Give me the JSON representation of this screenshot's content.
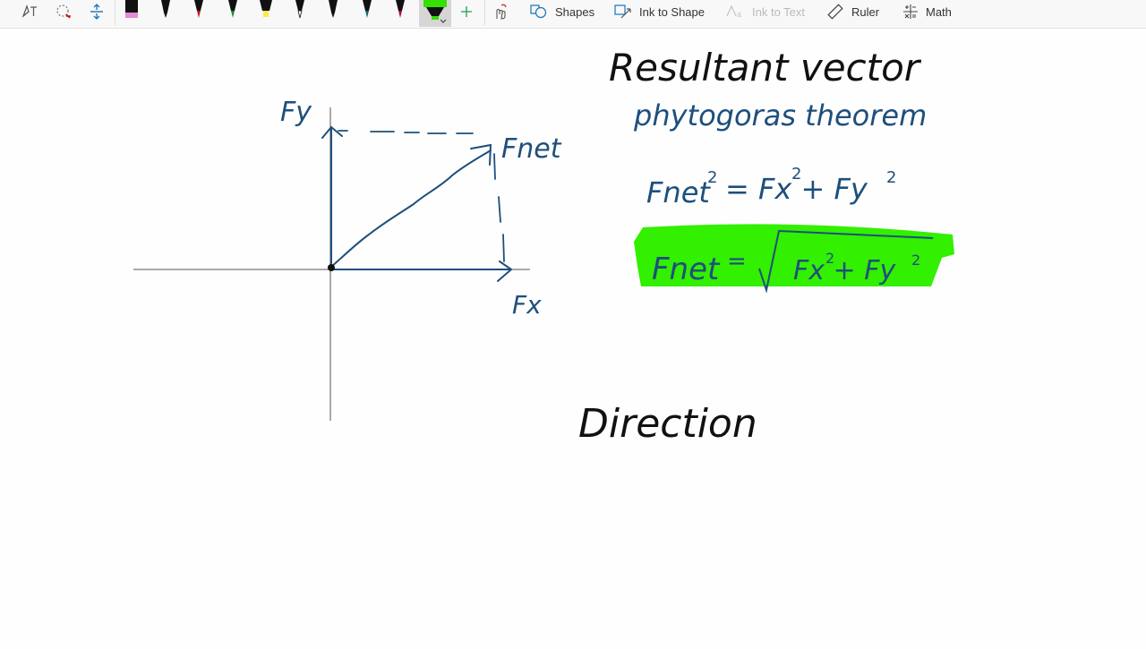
{
  "toolbar": {
    "shapes_label": "Shapes",
    "ink_to_shape_label": "Ink to Shape",
    "ink_to_text_label": "Ink to Text",
    "ruler_label": "Ruler",
    "math_label": "Math",
    "pens": [
      {
        "name": "black-highlighter",
        "color": "#111111",
        "tip": "#e58ad6"
      },
      {
        "name": "black-pen",
        "color": "#111111",
        "tip": "#111111"
      },
      {
        "name": "red-pen",
        "color": "#111111",
        "tip": "#c8102e"
      },
      {
        "name": "green-pen",
        "color": "#111111",
        "tip": "#1a8a2a"
      },
      {
        "name": "yellow-highlighter",
        "color": "#111111",
        "tip": "#ffe84a"
      },
      {
        "name": "white-pen",
        "color": "#111111",
        "tip": "#ffffff"
      },
      {
        "name": "black-pen-2",
        "color": "#111111",
        "tip": "#111111"
      },
      {
        "name": "teal-pen",
        "color": "#111111",
        "tip": "#0f6a6a"
      },
      {
        "name": "crimson-pen",
        "color": "#111111",
        "tip": "#b0102a"
      },
      {
        "name": "green-highlighter",
        "color": "#111111",
        "tip": "#33e000"
      }
    ]
  },
  "canvas": {
    "ink_blue": "#1d4f7c",
    "ink_black": "#111111",
    "highlight_green": "#33ef00",
    "label_fy": "Fy",
    "label_fx": "Fx",
    "label_fnet": "Fnet",
    "title": "Resultant vector",
    "subtitle": "phytogoras theorem",
    "equation_lhs": "Fnet",
    "equation_rhs": "= Fx + Fy",
    "boxed_lhs": "Fnet",
    "boxed_eq": "=",
    "boxed_rhs": "Fx + Fy",
    "superscript": "2",
    "direction_label": "Direction"
  }
}
